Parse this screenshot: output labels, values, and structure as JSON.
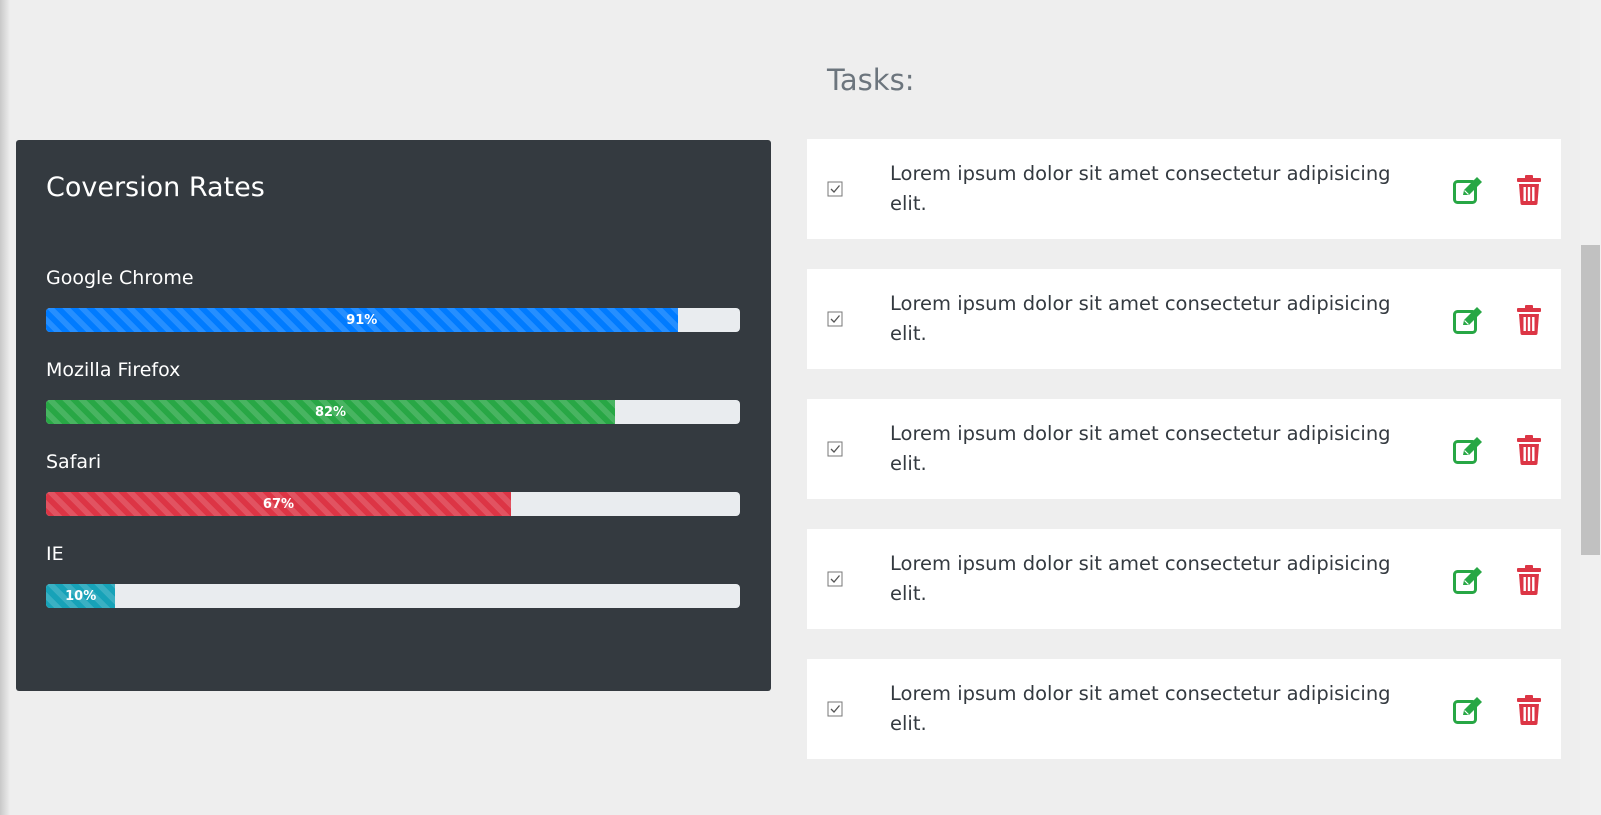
{
  "colors": {
    "page_bg": "#eeeeee",
    "card_bg": "#343a40",
    "track": "#e9ecef",
    "edit": "#28a745",
    "delete": "#dc3545"
  },
  "conversion": {
    "title": "Coversion Rates",
    "bars": [
      {
        "label": "Google Chrome",
        "percent": 91,
        "text": "91%",
        "color": "#007bff"
      },
      {
        "label": "Mozilla Firefox",
        "percent": 82,
        "text": "82%",
        "color": "#28a745"
      },
      {
        "label": "Safari",
        "percent": 67,
        "text": "67%",
        "color": "#dc3545"
      },
      {
        "label": "IE",
        "percent": 10,
        "text": "10%",
        "color": "#17a2b8"
      }
    ]
  },
  "tasks": {
    "heading": "Tasks:",
    "items": [
      {
        "text": "Lorem ipsum dolor sit amet consectetur adipisicing elit.",
        "checked": true,
        "edit_icon": "edit-icon",
        "delete_icon": "trash-icon"
      },
      {
        "text": "Lorem ipsum dolor sit amet consectetur adipisicing elit.",
        "checked": true,
        "edit_icon": "edit-icon",
        "delete_icon": "trash-icon"
      },
      {
        "text": "Lorem ipsum dolor sit amet consectetur adipisicing elit.",
        "checked": true,
        "edit_icon": "edit-icon",
        "delete_icon": "trash-icon"
      },
      {
        "text": "Lorem ipsum dolor sit amet consectetur adipisicing elit.",
        "checked": true,
        "edit_icon": "edit-icon",
        "delete_icon": "trash-icon"
      },
      {
        "text": "Lorem ipsum dolor sit amet consectetur adipisicing elit.",
        "checked": true,
        "edit_icon": "edit-icon",
        "delete_icon": "trash-icon"
      }
    ]
  }
}
